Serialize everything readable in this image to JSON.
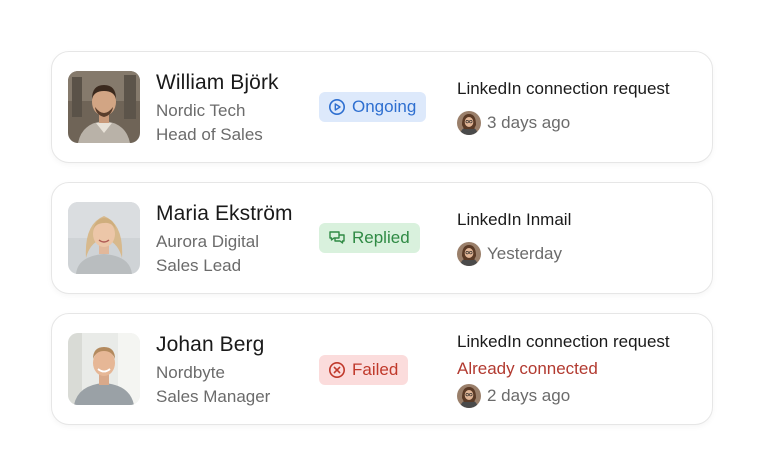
{
  "prospects": [
    {
      "name": "William Björk",
      "company": "Nordic Tech",
      "role": "Head of Sales",
      "status": "Ongoing",
      "status_icon": "play-circle-icon",
      "activity": "LinkedIn connection request",
      "sub_status": "",
      "time": "3 days ago"
    },
    {
      "name": "Maria Ekström",
      "company": "Aurora Digital",
      "role": "Sales Lead",
      "status": "Replied",
      "status_icon": "chat-bubbles-icon",
      "activity": "LinkedIn Inmail",
      "sub_status": "",
      "time": "Yesterday"
    },
    {
      "name": "Johan Berg",
      "company": "Nordbyte",
      "role": "Sales Manager",
      "status": "Failed",
      "status_icon": "x-circle-icon",
      "activity": "LinkedIn connection request",
      "sub_status": "Already connected",
      "time": "2 days ago"
    }
  ],
  "colors": {
    "ongoing_bg": "#dde9fb",
    "ongoing_fg": "#2e6fd0",
    "replied_bg": "#d9f1dd",
    "replied_fg": "#2f8a44",
    "failed_bg": "#fbdcdc",
    "failed_fg": "#c0392b",
    "error_text": "#b23a30"
  }
}
